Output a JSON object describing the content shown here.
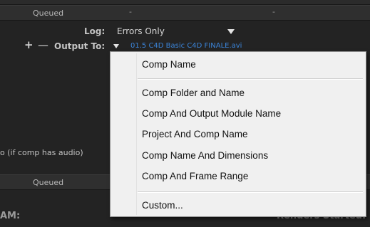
{
  "render_queue": {
    "rows": [
      {
        "status": "Queued",
        "col1": "-",
        "col2": "-"
      },
      {
        "status": "Queued"
      }
    ],
    "log_label": "Log:",
    "log_value": "Errors Only",
    "output_label": "Output To:",
    "output_file": "01.5 C4D Basic C4D FINALE.avi",
    "plus_label": "+",
    "minus_label": "—",
    "audio_note": "o (if comp has audio)",
    "footer_left": "AM:",
    "footer_right": "Renders Started:"
  },
  "menu": {
    "items": [
      {
        "label": "Comp Name"
      },
      {
        "label": "Comp Folder and Name"
      },
      {
        "label": "Comp And Output Module Name"
      },
      {
        "label": "Project And Comp Name"
      },
      {
        "label": "Comp Name And Dimensions"
      },
      {
        "label": "Comp And Frame Range"
      },
      {
        "label": "Custom..."
      }
    ]
  },
  "colors": {
    "panel_bg": "#232323",
    "menu_bg": "#f0f0f0",
    "link_blue": "#3b84d8"
  }
}
